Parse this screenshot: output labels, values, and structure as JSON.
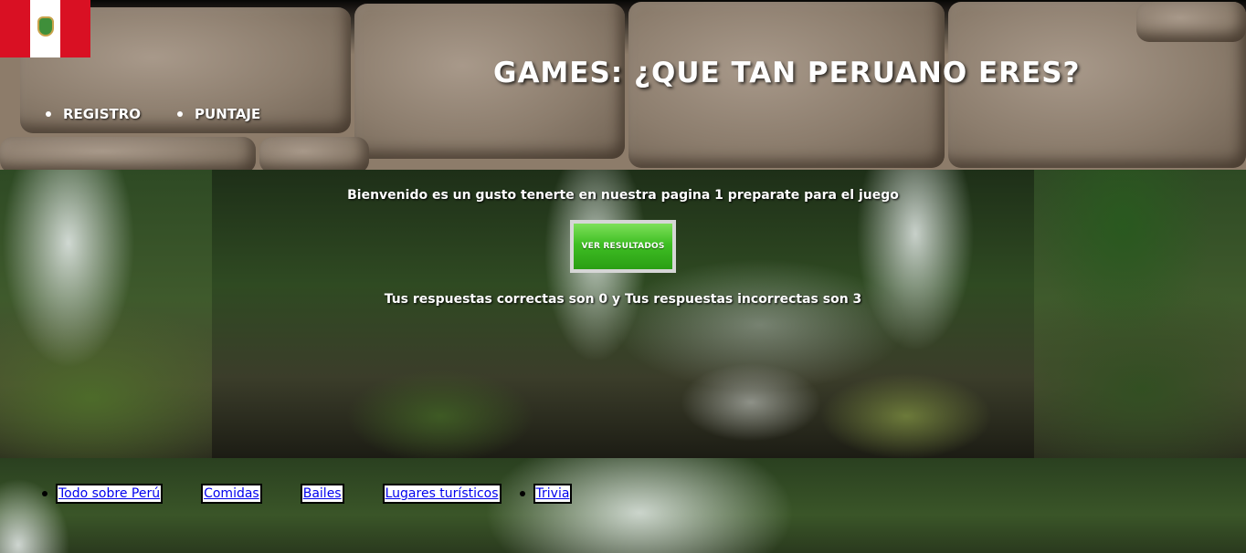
{
  "header": {
    "title": "GAMES: ¿QUE TAN PERUANO ERES?",
    "flag_colors": {
      "red": "#d91023",
      "white": "#ffffff"
    },
    "nav": [
      {
        "label": "REGISTRO"
      },
      {
        "label": "PUNTAJE"
      }
    ]
  },
  "main": {
    "welcome_text": "Bienvenido es un gusto tenerte en nuestra pagina 1 preparate para el juego",
    "results_button": {
      "label": "VER RESULTADOS",
      "color": "#3fbf24"
    },
    "score_text": "Tus respuestas correctas son 0 y Tus respuestas incorrectas son 3"
  },
  "bottom_nav": {
    "links": [
      {
        "label": "Todo sobre Perú"
      },
      {
        "label": "Comidas"
      },
      {
        "label": "Bailes"
      },
      {
        "label": "Lugares turísticos"
      },
      {
        "label": "Trivia"
      }
    ],
    "link_color": "#0000ee"
  }
}
